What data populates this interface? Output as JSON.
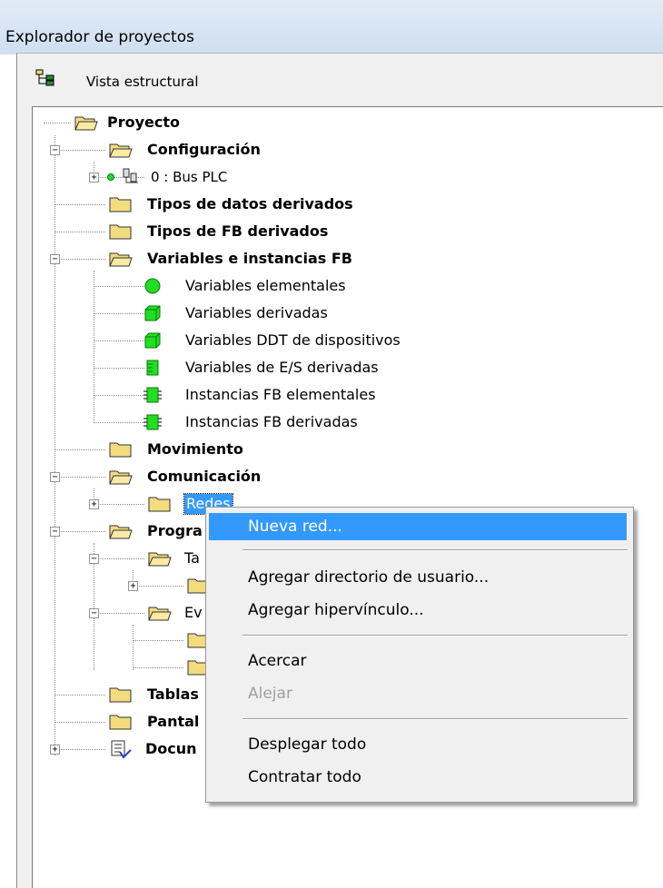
{
  "window": {
    "title": "Explorador de proyectos"
  },
  "toolbar": {
    "view_label": "Vista estructural"
  },
  "tree": {
    "proyecto": "Proyecto",
    "configuracion": "Configuración",
    "bus_plc": "0 : Bus PLC",
    "tipos_datos": "Tipos de datos derivados",
    "tipos_fb": "Tipos de FB derivados",
    "variables_fb": "Variables e instancias FB",
    "var_elementales": "Variables elementales",
    "var_derivadas": "Variables derivadas",
    "var_ddt": "Variables DDT de dispositivos",
    "var_es": "Variables de E/S derivadas",
    "fb_elementales": "Instancias FB elementales",
    "fb_derivadas": "Instancias FB derivadas",
    "movimiento": "Movimiento",
    "comunicacion": "Comunicación",
    "redes": "Redes",
    "programa": "Progra",
    "tareas": "Ta",
    "eventos": "Ev",
    "tablas": "Tablas",
    "pantallas": "Pantal",
    "documentacion": "Docun"
  },
  "context_menu": {
    "items": [
      {
        "label": "Nueva red...",
        "state": "highlighted"
      },
      {
        "label": "Agregar directorio de usuario...",
        "state": "enabled"
      },
      {
        "label": "Agregar hipervínculo...",
        "state": "enabled"
      },
      {
        "label": "Acercar",
        "state": "enabled"
      },
      {
        "label": "Alejar",
        "state": "disabled"
      },
      {
        "label": "Desplegar todo",
        "state": "enabled"
      },
      {
        "label": "Contratar todo",
        "state": "enabled"
      }
    ]
  },
  "colors": {
    "selection": "#3399ff",
    "folder": "#f3dc7e",
    "variable_green": "#22dd22",
    "panel_bg": "#f0f0f0"
  },
  "icons": [
    "structure-view-icon",
    "folder-icon",
    "folder-open-icon",
    "bus-icon",
    "green-circle-icon",
    "green-cube-icon",
    "green-chip-icon",
    "document-icon"
  ]
}
